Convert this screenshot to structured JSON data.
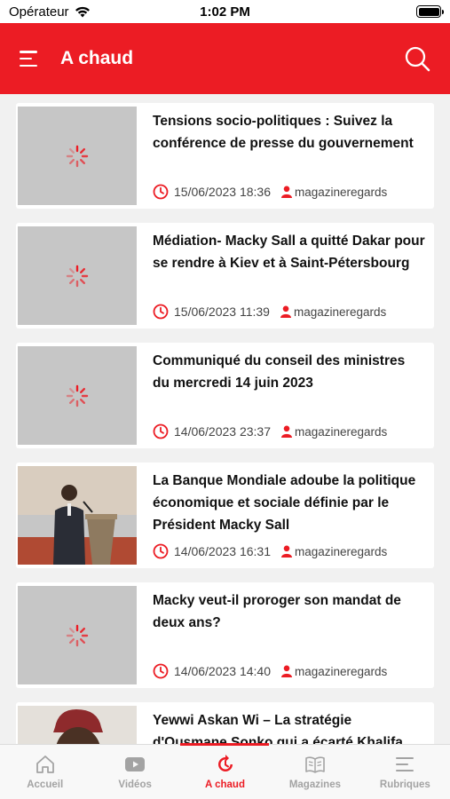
{
  "status_bar": {
    "carrier": "Opérateur",
    "time": "1:02 PM"
  },
  "header": {
    "title": "A chaud"
  },
  "articles": [
    {
      "title": "Tensions socio-politiques : Suivez la conférence de presse du gouvernement",
      "date": "15/06/2023 18:36",
      "author": "magazineregards",
      "image": "loading"
    },
    {
      "title": "Médiation- Macky Sall a quitté Dakar pour se rendre à Kiev et à Saint-Pétersbourg",
      "date": "15/06/2023 11:39",
      "author": "magazineregards",
      "image": "loading"
    },
    {
      "title": "Communiqué du conseil des ministres du mercredi 14 juin 2023",
      "date": "14/06/2023 23:37",
      "author": "magazineregards",
      "image": "loading"
    },
    {
      "title": "La Banque Mondiale adoube la politique économique et sociale définie par le Président Macky Sall",
      "date": "14/06/2023 16:31",
      "author": "magazineregards",
      "image": "photo"
    },
    {
      "title": "Macky veut-il proroger son mandat de deux ans?",
      "date": "14/06/2023 14:40",
      "author": "magazineregards",
      "image": "loading"
    },
    {
      "title": "Yewwi Askan Wi – La stratégie d'Ousmane Sonko qui a écarté Khalifa",
      "date": "",
      "author": "",
      "image": "photo"
    }
  ],
  "tabs": [
    {
      "label": "Accueil",
      "icon": "home-icon"
    },
    {
      "label": "Vidéos",
      "icon": "video-icon"
    },
    {
      "label": "A chaud",
      "icon": "hot-icon",
      "active": true
    },
    {
      "label": "Magazines",
      "icon": "magazine-icon"
    },
    {
      "label": "Rubriques",
      "icon": "menu-icon"
    }
  ],
  "colors": {
    "accent": "#ec1c24",
    "inactive_tab": "#a3a3a3",
    "background": "#f1f1f1"
  }
}
